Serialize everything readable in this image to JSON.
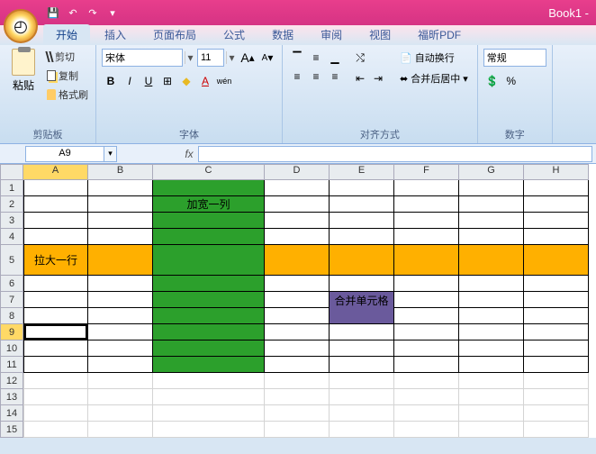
{
  "title": "Book1 - ",
  "tabs": [
    "开始",
    "插入",
    "页面布局",
    "公式",
    "数据",
    "审阅",
    "视图",
    "福昕PDF"
  ],
  "active_tab": 0,
  "clipboard": {
    "paste": "粘贴",
    "cut": "剪切",
    "copy": "复制",
    "brush": "格式刷",
    "label": "剪贴板"
  },
  "font": {
    "name": "宋体",
    "size": "11",
    "label": "字体",
    "btns": {
      "bold": "B",
      "italic": "I",
      "underline": "U",
      "border": "⊞",
      "fill": "◆",
      "color": "A",
      "grow": "A",
      "shrink": "A",
      "wen": "wén"
    }
  },
  "align": {
    "label": "对齐方式",
    "wrap": "自动换行",
    "merge": "合并后居中"
  },
  "number": {
    "label": "数字",
    "format": "常规"
  },
  "namebox": "A9",
  "fx": "fx",
  "formula": "",
  "cols": [
    "A",
    "B",
    "C",
    "D",
    "E",
    "F",
    "G",
    "H"
  ],
  "rows": [
    "1",
    "2",
    "3",
    "4",
    "5",
    "6",
    "7",
    "8",
    "9",
    "10",
    "11",
    "12",
    "13",
    "14",
    "15"
  ],
  "cells": {
    "C2": "加宽一列",
    "A5": "拉大一行",
    "E7": "合并单元格"
  }
}
